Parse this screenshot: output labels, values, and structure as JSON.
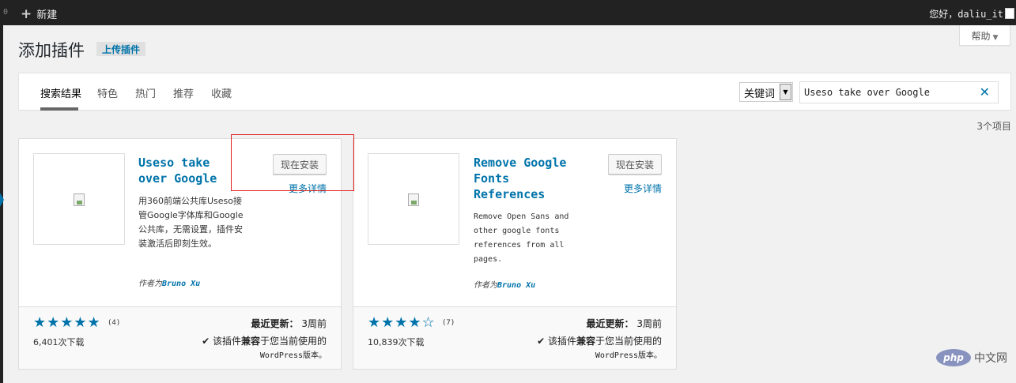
{
  "adminbar": {
    "left_number": "0",
    "new_label": "新建",
    "greeting": "您好，daliu_it"
  },
  "help_tab": {
    "label": "帮助",
    "caret": "▼"
  },
  "page": {
    "title": "添加插件",
    "upload_button": "上传插件"
  },
  "filter": {
    "tabs": [
      {
        "label": "搜索结果",
        "current": true
      },
      {
        "label": "特色"
      },
      {
        "label": "热门"
      },
      {
        "label": "推荐"
      },
      {
        "label": "收藏"
      }
    ],
    "search_type": "关键词",
    "search_value": "Useso take over Google"
  },
  "result_count": "3个项目",
  "plugins": [
    {
      "name": "Useso take over Google",
      "install_label": "现在安装",
      "more_details": "更多详情",
      "description": "用360前端公共库Useso接管Google字体库和Google公共库，无需设置，插件安装激活后即刻生效。",
      "author_prefix": "作者为",
      "author": "Bruno Xu",
      "rating_stars": 5,
      "stars": "★★★★★",
      "rating_count": "(4)",
      "downloads": "6,401次下载",
      "updated_label": "最近更新：",
      "updated_value": "3周前",
      "compat_prefix": "✔ 该插件",
      "compat_bold": "兼容",
      "compat_suffix": "于您当前使用的",
      "compat_version": "WordPress版本。"
    },
    {
      "name": "Remove Google Fonts References",
      "install_label": "现在安装",
      "more_details": "更多详情",
      "description": "Remove Open Sans and other google fonts references from all pages.",
      "author_prefix": "作者为",
      "author": "Bruno Xu",
      "rating_stars": 4.5,
      "stars": "★★★★☆",
      "rating_count": "(7)",
      "downloads": "10,839次下载",
      "updated_label": "最近更新：",
      "updated_value": "3周前",
      "compat_prefix": "✔ 该插件",
      "compat_bold": "兼容",
      "compat_suffix": "于您当前使用的",
      "compat_version": "WordPress版本。"
    }
  ],
  "watermark": {
    "logo": "php",
    "text": "中文网"
  },
  "colors": {
    "link": "#0073aa",
    "adminbar": "#222222",
    "highlight": "#e02020"
  }
}
